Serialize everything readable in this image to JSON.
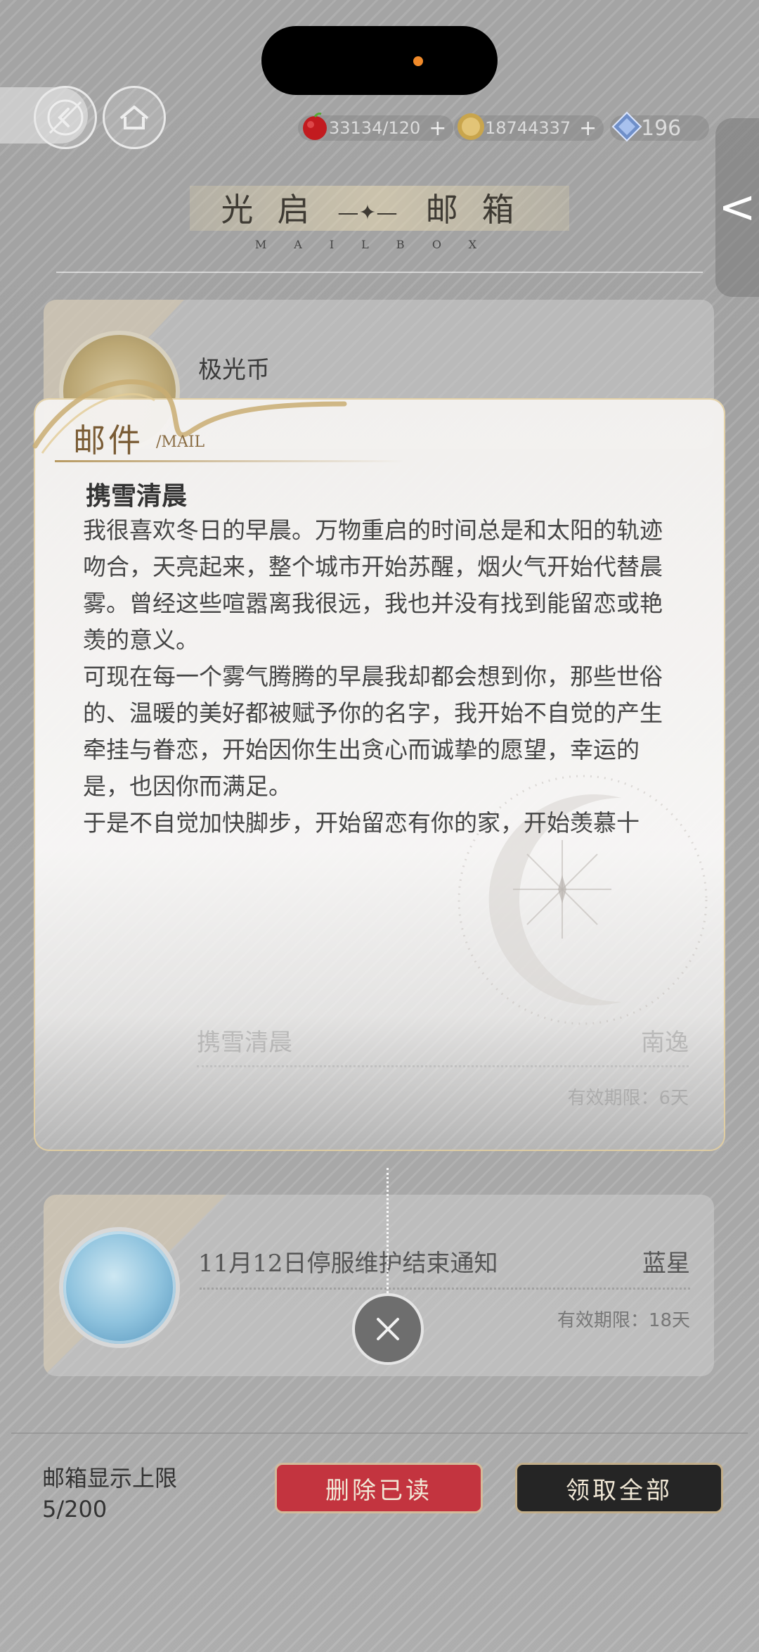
{
  "header": {
    "resources": [
      {
        "name": "apple",
        "value": "33134/120",
        "icon": "apple-icon"
      },
      {
        "name": "coin",
        "value": "18744337",
        "icon": "coin-icon"
      },
      {
        "name": "gem",
        "value": "196",
        "icon": "gem-icon"
      }
    ],
    "side_tab_glyph": "<"
  },
  "title": {
    "text": "光启 邮箱",
    "left": "光启",
    "right": "邮箱",
    "subtitle": "MAILBOX"
  },
  "mails": [
    {
      "title": "极光币"
    },
    {
      "title": "携雪清晨",
      "sender": "南逸",
      "expiry": "有效期限：6天"
    },
    {
      "title": "11月12日停服维护结束通知",
      "sender": "蓝星",
      "expiry": "有效期限：18天"
    }
  ],
  "letter": {
    "label": "邮件",
    "label_sub": "/MAIL",
    "heading": "携雪清晨",
    "paragraphs": [
      "我很喜欢冬日的早晨。万物重启的时间总是和太阳的轨迹吻合，天亮起来，整个城市开始苏醒，烟火气开始代替晨雾。曾经这些喧嚣离我很远，我也并没有找到能留恋或艳羡的意义。",
      "可现在每一个雾气腾腾的早晨我却都会想到你，那些世俗的、温暖的美好都被赋予你的名字，我开始不自觉的产生牵挂与眷恋，开始因你生出贪心而诚挚的愿望，幸运的是，也因你而满足。",
      "于是不自觉加快脚步，开始留恋有你的家，开始羡慕十"
    ]
  },
  "footer": {
    "limit_label": "邮箱显示上限",
    "limit_value": "5/200",
    "delete_label": "删除已读",
    "claim_label": "领取全部"
  },
  "colors": {
    "delete_button": "#c3343f",
    "claim_button": "#252525",
    "letter_accent": "#7a5c35"
  }
}
